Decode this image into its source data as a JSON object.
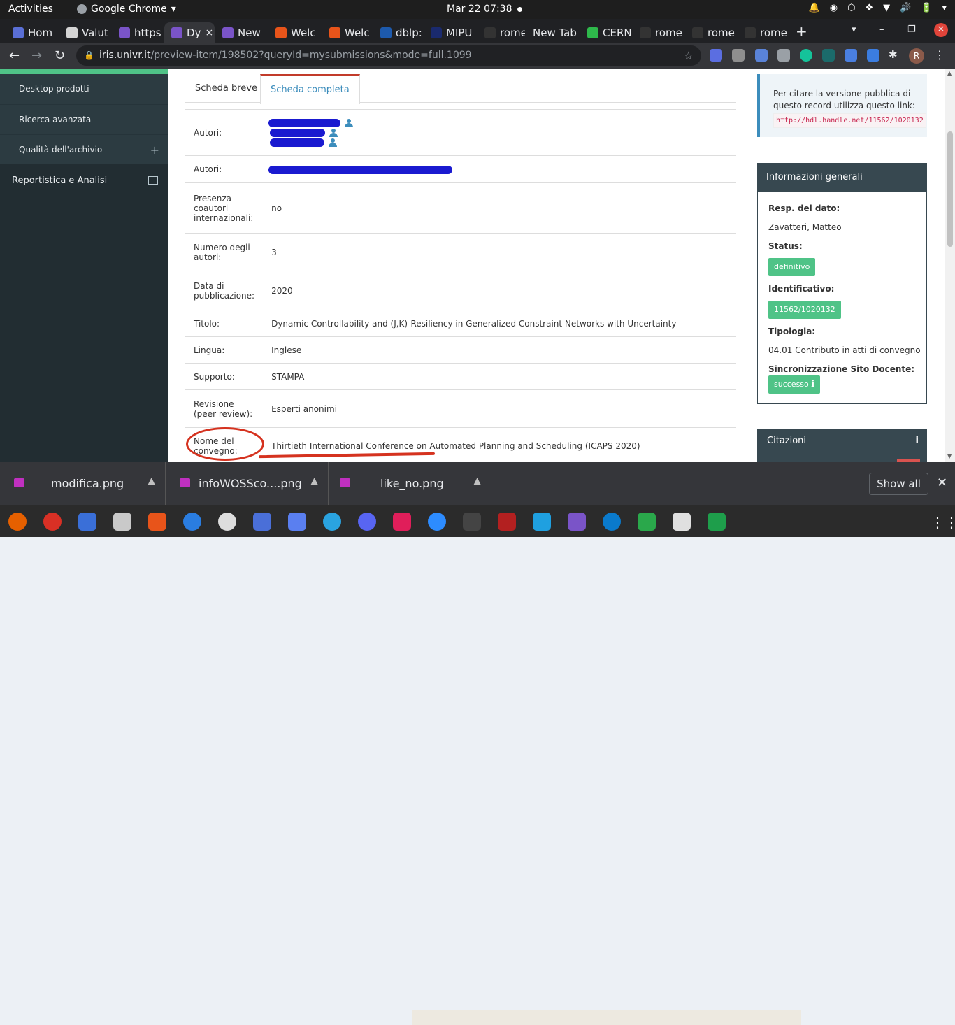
{
  "os": {
    "activities": "Activities",
    "app": "Google Chrome",
    "app_caret": "▾",
    "clock": "Mar 22  07:38",
    "tray": [
      "🔔",
      "◉",
      "⬡",
      "❖",
      "▼",
      "🔊",
      "🔋",
      "▾"
    ]
  },
  "browser": {
    "tabs": [
      {
        "label": "Hom",
        "fav": "#5a6fd6"
      },
      {
        "label": "Valut",
        "fav": "#d4d4d4"
      },
      {
        "label": "https",
        "fav": "#7a54c8"
      },
      {
        "label": "Dy",
        "fav": "#7a54c8",
        "active": true
      },
      {
        "label": "New",
        "fav": "#7a54c8"
      },
      {
        "label": "Welc",
        "fav": "#e8541a"
      },
      {
        "label": "Welc",
        "fav": "#e8541a"
      },
      {
        "label": "dblp:",
        "fav": "#1d5aad"
      },
      {
        "label": "MIPU",
        "fav": "#1a2a6e"
      },
      {
        "label": "rome",
        "fav": "#333333"
      },
      {
        "label": "New Tab",
        "fav": ""
      },
      {
        "label": "CERN",
        "fav": "#2eb84b"
      },
      {
        "label": "rome",
        "fav": "#333333"
      },
      {
        "label": "rome",
        "fav": "#333333"
      },
      {
        "label": "rome",
        "fav": "#333333"
      }
    ],
    "close_glyph": "×",
    "newtab": "+",
    "url_host": "iris.univr.it",
    "url_rest": "/preview-item/198502?queryId=mysubmissions&mode=full.1099",
    "profile_initial": "R",
    "win_controls": [
      "▾",
      "–",
      "❐",
      "✕"
    ]
  },
  "sidebar": {
    "items": [
      {
        "label": "Desktop prodotti"
      },
      {
        "label": "Ricerca avanzata"
      },
      {
        "label": "Qualità dell'archivio",
        "expand": "+"
      }
    ],
    "section": "Reportistica e Analisi"
  },
  "record": {
    "tabs": [
      "Scheda breve",
      "Scheda completa"
    ],
    "rows": [
      {
        "key": "Autori:",
        "value": ""
      },
      {
        "key": "Autori:",
        "value": ""
      },
      {
        "key": "Presenza coautori internazionali:",
        "value": "no"
      },
      {
        "key": "Numero degli autori:",
        "value": "3"
      },
      {
        "key": "Data di pubblicazione:",
        "value": "2020"
      },
      {
        "key": "Titolo:",
        "value": "Dynamic Controllability and (J,K)-Resiliency in Generalized Constraint Networks with Uncertainty"
      },
      {
        "key": "Lingua:",
        "value": "Inglese"
      },
      {
        "key": "Supporto:",
        "value": "STAMPA"
      },
      {
        "key": "Revisione (peer review):",
        "value": "Esperti anonimi"
      },
      {
        "key": "Nome del convegno:",
        "value": "Thirtieth International Conference on Automated Planning and Scheduling (ICAPS 2020)"
      }
    ]
  },
  "cite": {
    "text": "Per citare la versione pubblica di questo record utilizza questo link:",
    "link": "http://hdl.handle.net/11562/1020132"
  },
  "info": {
    "title": "Informazioni generali",
    "resp_label": "Resp. del dato:",
    "resp_value": "Zavatteri, Matteo",
    "status_label": "Status:",
    "status_value": "definitivo",
    "id_label": "Identificativo:",
    "id_value": "11562/1020132",
    "type_label": "Tipologia:",
    "type_value": "04.01 Contributo in atti di convegno",
    "sync_label": "Sincronizzazione Sito Docente:",
    "sync_value": "successo",
    "sync_info": "ℹ"
  },
  "citations": {
    "title": "Citazioni",
    "info": "i"
  },
  "downloads": {
    "files": [
      "modifica.png",
      "infoWOSSco....png",
      "like_no.png"
    ],
    "chevron": "▲",
    "show_all": "Show all",
    "close": "✕"
  },
  "colors": {
    "accent": "#3c8dbc",
    "success": "#4fc387",
    "sidebar": "#222d32",
    "annotation": "#d5321f"
  }
}
